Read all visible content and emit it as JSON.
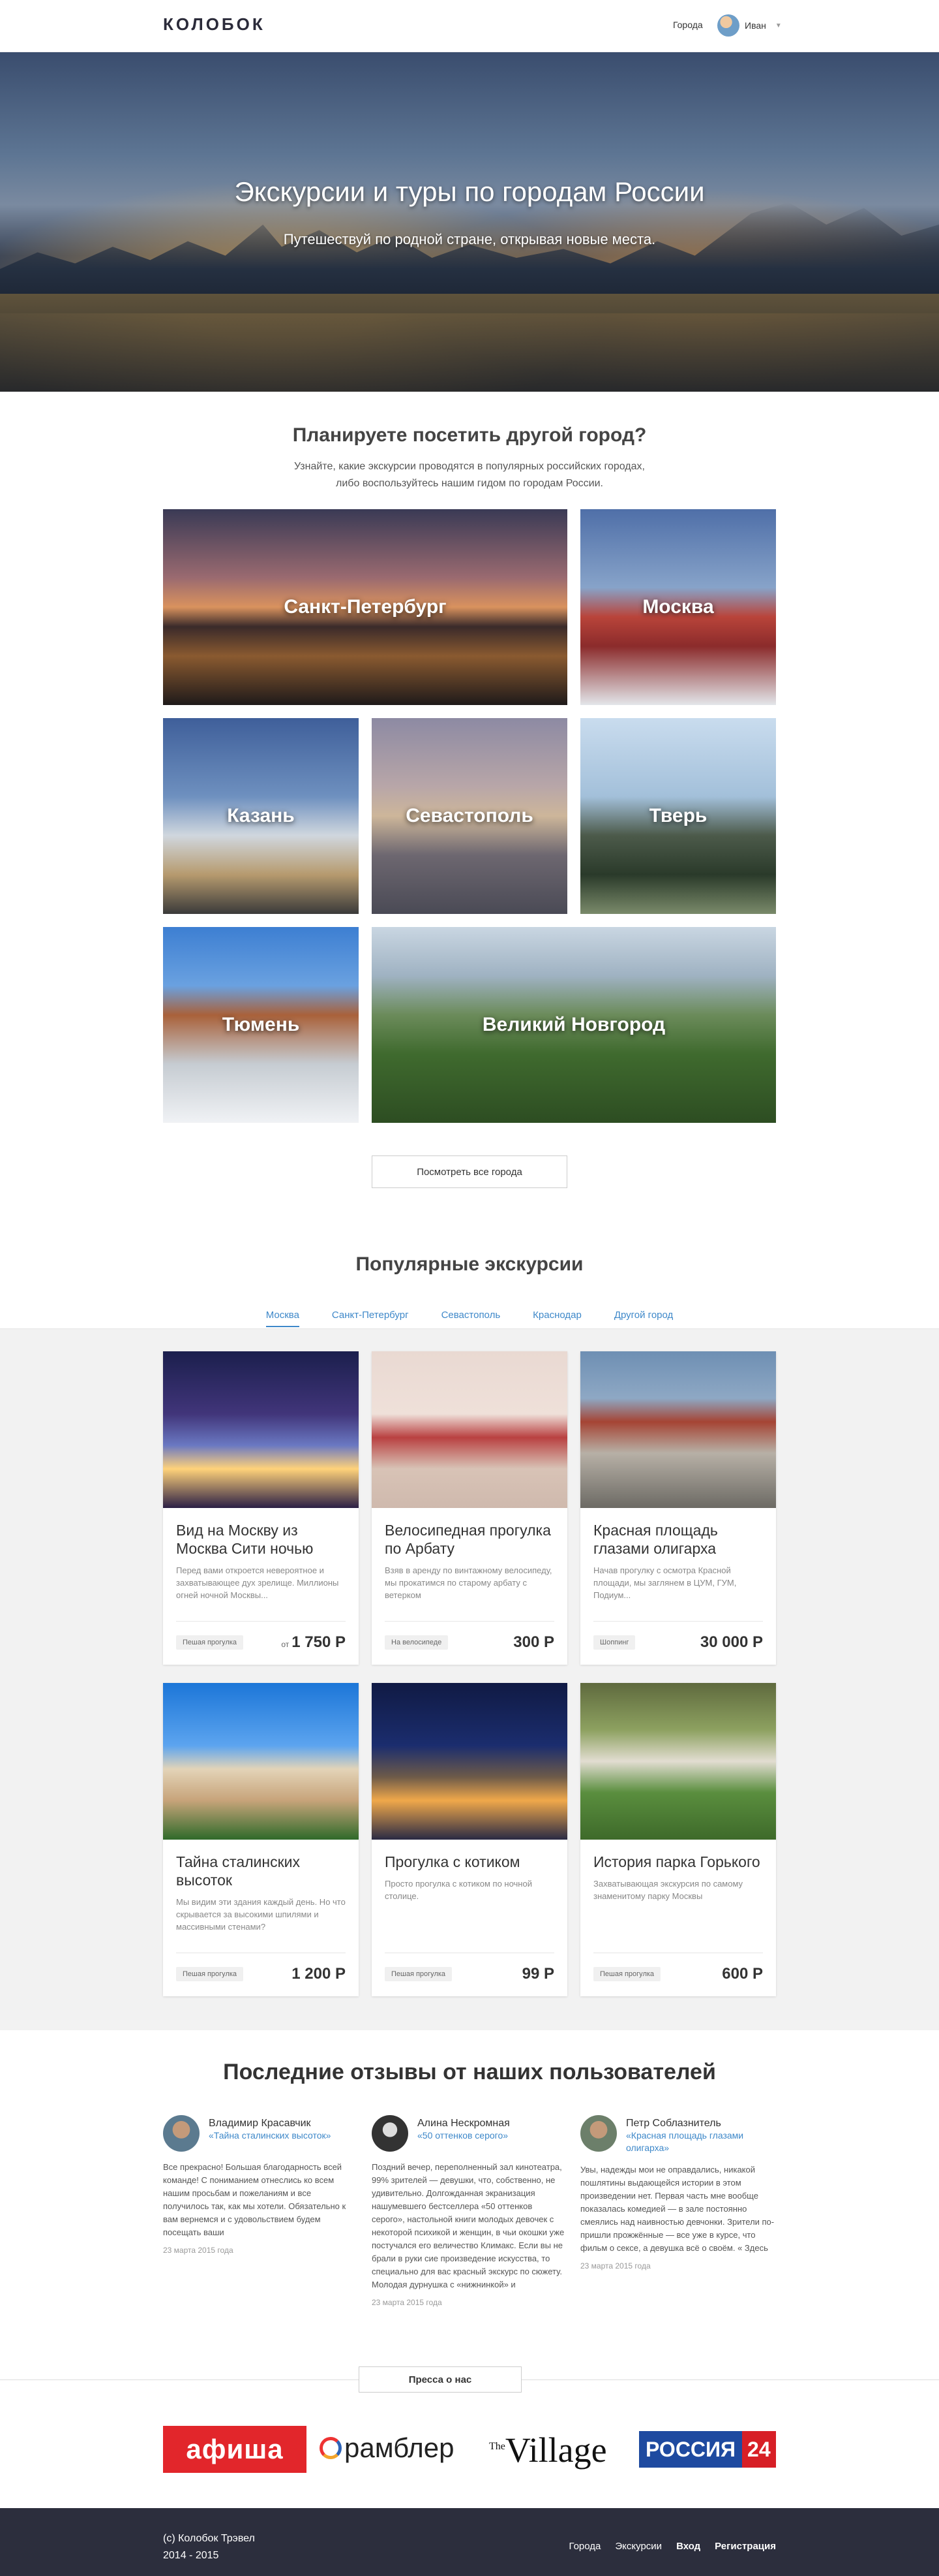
{
  "header": {
    "logo": "КОЛОБОК",
    "nav_cities": "Города",
    "user_name": "Иван"
  },
  "hero": {
    "title": "Экскурсии и туры по городам России",
    "subtitle": "Путешествуй по родной стране, открывая новые места."
  },
  "cities_section": {
    "title": "Планируете посетить другой город?",
    "text_line1": "Узнайте, какие экскурсии проводятся в популярных российских городах,",
    "text_line2": "либо воспользуйтесь нашим гидом по городам России.",
    "cities": [
      "Санкт-Петербург",
      "Москва",
      "Казань",
      "Севастополь",
      "Тверь",
      "Тюмень",
      "Великий Новгород"
    ],
    "all_button": "Посмотреть все города"
  },
  "popular": {
    "title": "Популярные экскурсии",
    "tabs": [
      "Москва",
      "Санкт-Петербург",
      "Севастополь",
      "Краснодар",
      "Другой город"
    ],
    "cards": [
      {
        "title": "Вид на Москву из Москва Сити ночью",
        "desc": "Перед вами откроется невероятное и захватывающее дух зрелище. Миллионы огней ночной Москвы...",
        "tag": "Пешая прогулка",
        "price_prefix": "от",
        "price": "1 750 Р"
      },
      {
        "title": "Велосипедная прогулка по Арбату",
        "desc": "Взяв в аренду по винтажному велосипеду, мы прокатимся по старому арбату с ветерком",
        "tag": "На велосипеде",
        "price_prefix": "",
        "price": "300 Р"
      },
      {
        "title": "Красная площадь глазами олигарха",
        "desc": "Начав прогулку с осмотра Красной площади, мы заглянем в ЦУМ, ГУМ, Подиум...",
        "tag": "Шоппинг",
        "price_prefix": "",
        "price": "30 000 Р"
      },
      {
        "title": "Тайна сталинских высоток",
        "desc": "Мы видим эти здания каждый день. Но что скрывается за высокими шпилями и массивными стенами?",
        "tag": "Пешая прогулка",
        "price_prefix": "",
        "price": "1 200 Р"
      },
      {
        "title": "Прогулка с котиком",
        "desc": "Просто прогулка с котиком по ночной столице.",
        "tag": "Пешая прогулка",
        "price_prefix": "",
        "price": "99 Р"
      },
      {
        "title": "История парка Горького",
        "desc": "Захватывающая экскурсия по самому знаменитому парку Москвы",
        "tag": "Пешая прогулка",
        "price_prefix": "",
        "price": "600 Р"
      }
    ]
  },
  "reviews": {
    "title": "Последние отзывы от наших пользователей",
    "items": [
      {
        "name": "Владимир Красавчик",
        "tour": "«Тайна сталинских высоток»",
        "text": "Все прекрасно! Большая благодарность всей команде! С пониманием отнеслись ко всем нашим просьбам и пожеланиям и все получилось так, как мы хотели. Обязательно к вам вернемся и с удовольствием будем посещать ваши",
        "date": "23 марта 2015 года"
      },
      {
        "name": "Алина Нескромная",
        "tour": "«50 оттенков серого»",
        "text": "Поздний вечер, переполненный зал кинотеатра, 99% зрителей — девушки, что, собственно, не удивительно. Долгожданная экранизация нашумевшего бестселлера «50 оттенков серого», настольной книги молодых девочек с некоторой психикой и женщин, в чьи окошки уже постучался его величество Климакс. Если вы не брали в руки сие произведение искусства, то специально для вас красный экскурс по сюжету. Молодая дурнушка с «нижнинкой» и",
        "date": "23 марта 2015 года"
      },
      {
        "name": "Петр Соблазнитель",
        "tour": "«Красная площадь глазами олигарха»",
        "text": "Увы, надежды мои не оправдались, никакой пошлятины выдающейся истории в этом произведении нет. Первая часть мне вообще показалась комедией — в зале постоянно смеялись над наивностью девчонки. Зрители по-пришли прожжённые — все уже в курсе, что фильм о сексе, а девушка всё о своём. « Здесь",
        "date": "23 марта 2015 года"
      }
    ]
  },
  "press": {
    "button": "Пресса о нас",
    "logos": [
      "афиша",
      "рамблер",
      "Village",
      "The",
      "РОССИЯ",
      "24"
    ]
  },
  "footer": {
    "copy_line1": "(c) Колобок Трэвел",
    "copy_line2": "2014 - 2015",
    "nav": [
      "Города",
      "Экскурсии",
      "Вход",
      "Регистрация"
    ]
  }
}
